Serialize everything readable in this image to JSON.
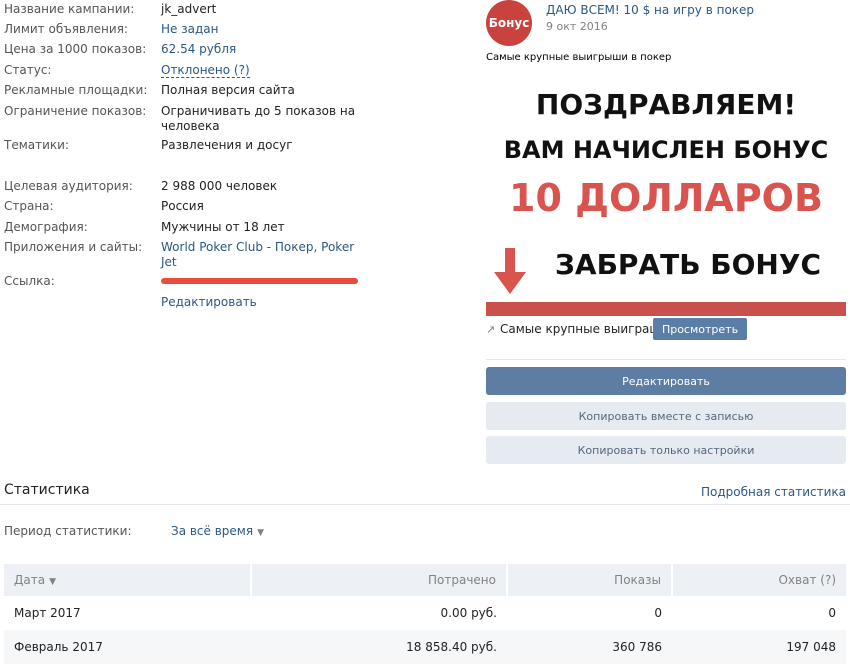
{
  "info": {
    "rows": [
      {
        "label": "Название кампании:",
        "value": "jk_advert"
      },
      {
        "label": "Лимит объявления:",
        "value": "Не задан"
      },
      {
        "label": "Цена за 1000 показов:",
        "value": "62.54 рубля"
      },
      {
        "label": "Статус:",
        "value": "Отклонено (?)"
      },
      {
        "label": "Рекламные площадки:",
        "value": "Полная версия сайта"
      },
      {
        "label": "Ограничение показов:",
        "value": "Ограничивать до 5 показов на человека"
      },
      {
        "label": "Тематики:",
        "value": "Развлечения и досуг"
      },
      {
        "label": "Целевая аудитория:",
        "value": "2 988 000 человек"
      },
      {
        "label": "Страна:",
        "value": "Россия"
      },
      {
        "label": "Демография:",
        "value": "Мужчины от 18 лет"
      },
      {
        "label": "Приложения и сайты:",
        "value": "World Poker Club - Покер, Poker Jet"
      },
      {
        "label": "Ссылка:",
        "value": ""
      }
    ],
    "edit_link": "Редактировать"
  },
  "post": {
    "avatar_text": "Бонус",
    "title": "ДАЮ ВСЕМ! 10 $ на игру в покер",
    "date": "9 окт 2016",
    "text": "Самые крупные выигрыши в покер",
    "banner": {
      "line1": "ПОЗДРАВЛЯЕМ!",
      "line2": "ВАМ НАЧИСЛЕН БОНУС",
      "line3": "10 ДОЛЛАРОВ",
      "line4": "ЗАБРАТЬ БОНУС"
    },
    "footer_text": "Самые крупные выиграши",
    "view_button": "Просмотреть"
  },
  "actions": {
    "edit": "Редактировать",
    "copy_with_post": "Копировать вместе с записью",
    "copy_settings": "Копировать только настройки"
  },
  "stats": {
    "title": "Статистика",
    "detailed_link": "Подробная статистика",
    "period_label": "Период статистики:",
    "period_value": "За всё время",
    "columns": [
      "Дата",
      "Потрачено",
      "Показы",
      "Охват (?)"
    ],
    "rows": [
      [
        "Март 2017",
        "0.00 руб.",
        "0",
        "0"
      ],
      [
        "Февраль 2017",
        "18 858.40 руб.",
        "360 786",
        "197 048"
      ]
    ]
  },
  "colors": {
    "accent": "#5d7da3",
    "link": "#2a5885",
    "banner_red": "#d9534f"
  }
}
